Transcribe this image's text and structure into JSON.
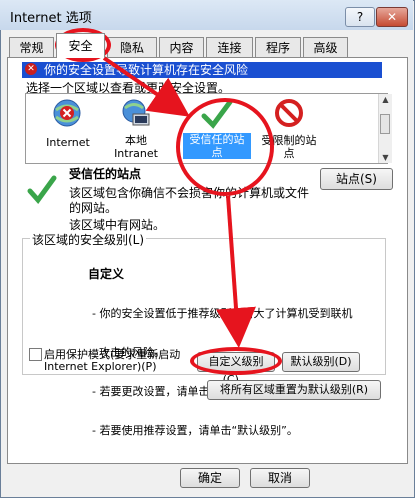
{
  "window": {
    "title": "Internet 选项",
    "help_label": "?",
    "close_label": "✕"
  },
  "tabs": [
    {
      "label": "常规"
    },
    {
      "label": "安全"
    },
    {
      "label": "隐私"
    },
    {
      "label": "内容"
    },
    {
      "label": "连接"
    },
    {
      "label": "程序"
    },
    {
      "label": "高级"
    }
  ],
  "warning": {
    "text": "你的安全设置导致计算机存在安全风险"
  },
  "zone_prompt": "选择一个区域以查看或更改安全设置。",
  "zones": [
    {
      "line1": "Internet",
      "line2": ""
    },
    {
      "line1": "本地",
      "line2": "Intranet"
    },
    {
      "line1": "受信任的站",
      "line2": "点"
    },
    {
      "line1": "受限制的站",
      "line2": "点"
    }
  ],
  "zone_info": {
    "title": "受信任的站点",
    "desc_line1": "该区域包含你确信不会损害你的计算机或文件",
    "desc_line2": "的网站。",
    "has_sites": "该区域中有网站。",
    "sites_button": "站点(S)"
  },
  "security_level": {
    "group_title": "该区域的安全级别(L)",
    "level_name": "自定义",
    "lines": [
      "- 你的安全设置低于推荐级别，增大了计算机受到联机",
      "  攻击的风险。",
      "- 若要更改设置，请单击“自定义级别”。",
      "- 若要使用推荐设置，请单击“默认级别”。"
    ]
  },
  "protected_mode": {
    "line1": "启用保护模式(要求重新启动",
    "line2": "Internet Explorer)(P)",
    "checked": false
  },
  "buttons": {
    "custom_level": "自定义级别(C)...",
    "default_level": "默认级别(D)",
    "reset_all": "将所有区域重置为默认级别(R)",
    "ok": "确定",
    "cancel": "取消"
  },
  "colors": {
    "annotation_red": "#e6141e",
    "warning_bar": "#1a4fd1",
    "selected_zone": "#3399ff"
  }
}
